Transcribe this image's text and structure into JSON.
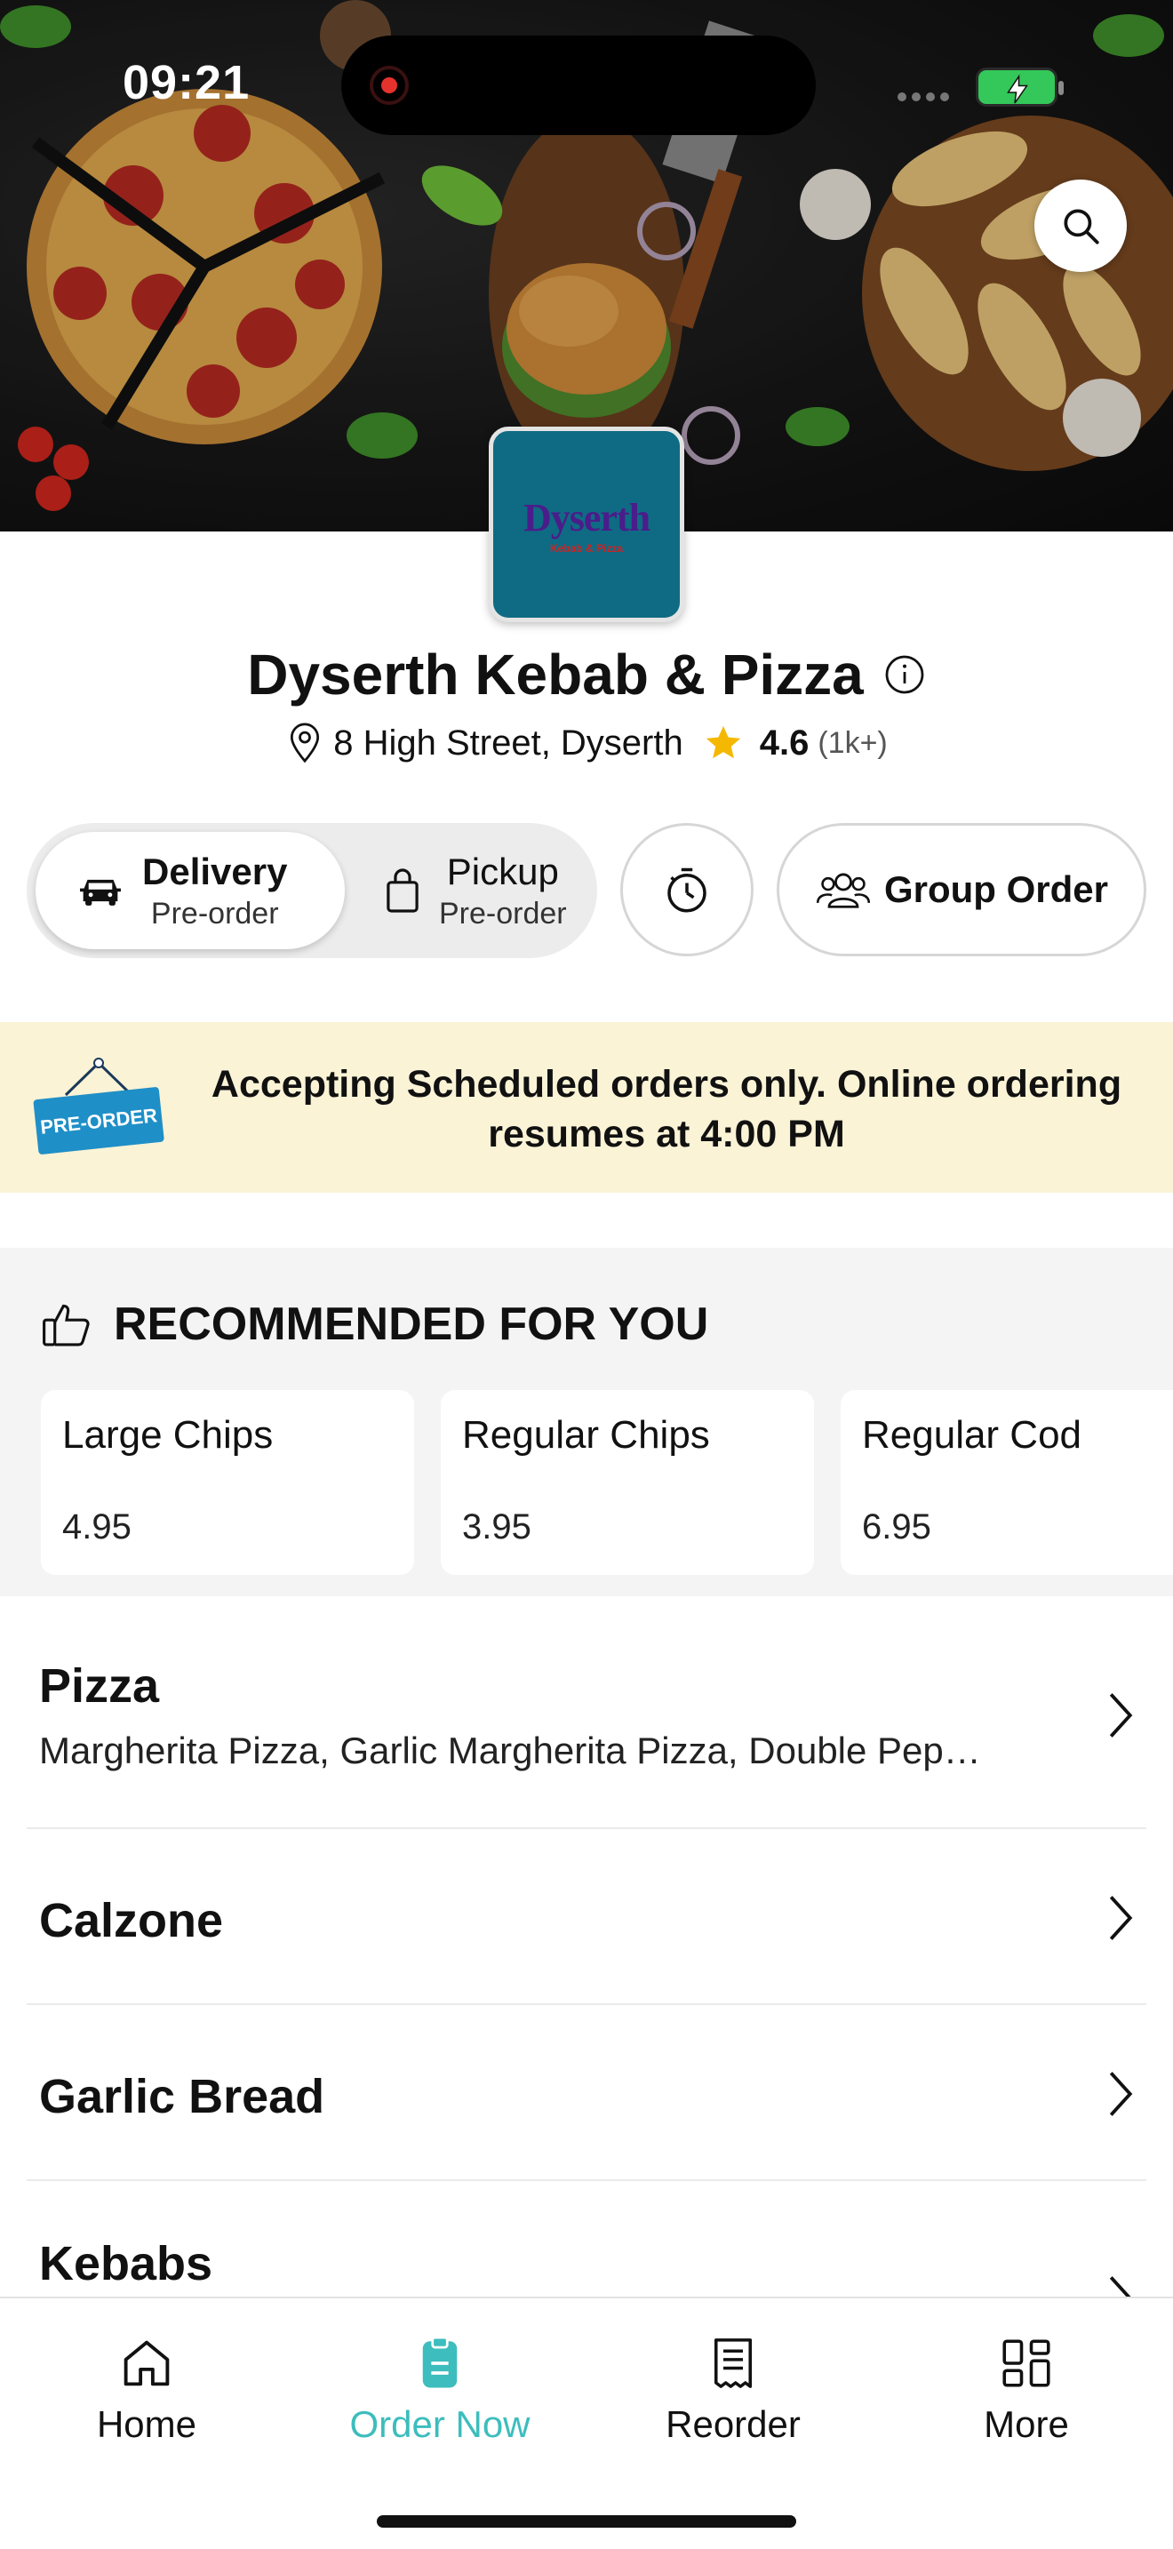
{
  "status_bar": {
    "time": "09:21"
  },
  "restaurant": {
    "logo_text": "Dyserth",
    "logo_subtext": "Kebab & Pizza",
    "name": "Dyserth Kebab & Pizza",
    "address": "8 High Street, Dyserth",
    "rating": "4.6",
    "rating_count": "(1k+)"
  },
  "order_mode": {
    "options": [
      {
        "label": "Delivery",
        "sub": "Pre-order",
        "icon": "car-icon",
        "selected": true
      },
      {
        "label": "Pickup",
        "sub": "Pre-order",
        "icon": "bag-icon",
        "selected": false
      }
    ],
    "timer_icon": "stopwatch-icon",
    "group_order_label": "Group Order"
  },
  "banner": {
    "tag": "PRE-ORDER",
    "message": "Accepting Scheduled orders only. Online ordering resumes at 4:00 PM"
  },
  "recommended": {
    "title": "RECOMMENDED FOR YOU",
    "items": [
      {
        "name": "Large Chips",
        "price": "4.95"
      },
      {
        "name": "Regular Chips",
        "price": "3.95"
      },
      {
        "name": "Regular Cod",
        "price": "6.95"
      }
    ]
  },
  "categories": [
    {
      "title": "Pizza",
      "description": "Margherita Pizza, Garlic Margherita Pizza, Double Pep…"
    },
    {
      "title": "Calzone"
    },
    {
      "title": "Garlic Bread"
    },
    {
      "title": "Kebabs"
    }
  ],
  "bottom_nav": {
    "items": [
      {
        "label": "Home",
        "icon": "home-icon"
      },
      {
        "label": "Order Now",
        "icon": "order-icon",
        "active": true
      },
      {
        "label": "Reorder",
        "icon": "receipt-icon"
      },
      {
        "label": "More",
        "icon": "grid-icon"
      }
    ]
  },
  "colors": {
    "accent": "#3dbdbd",
    "banner_bg": "#fbf3d6",
    "logo_bg": "#0f6b83",
    "star": "#f5b800"
  }
}
